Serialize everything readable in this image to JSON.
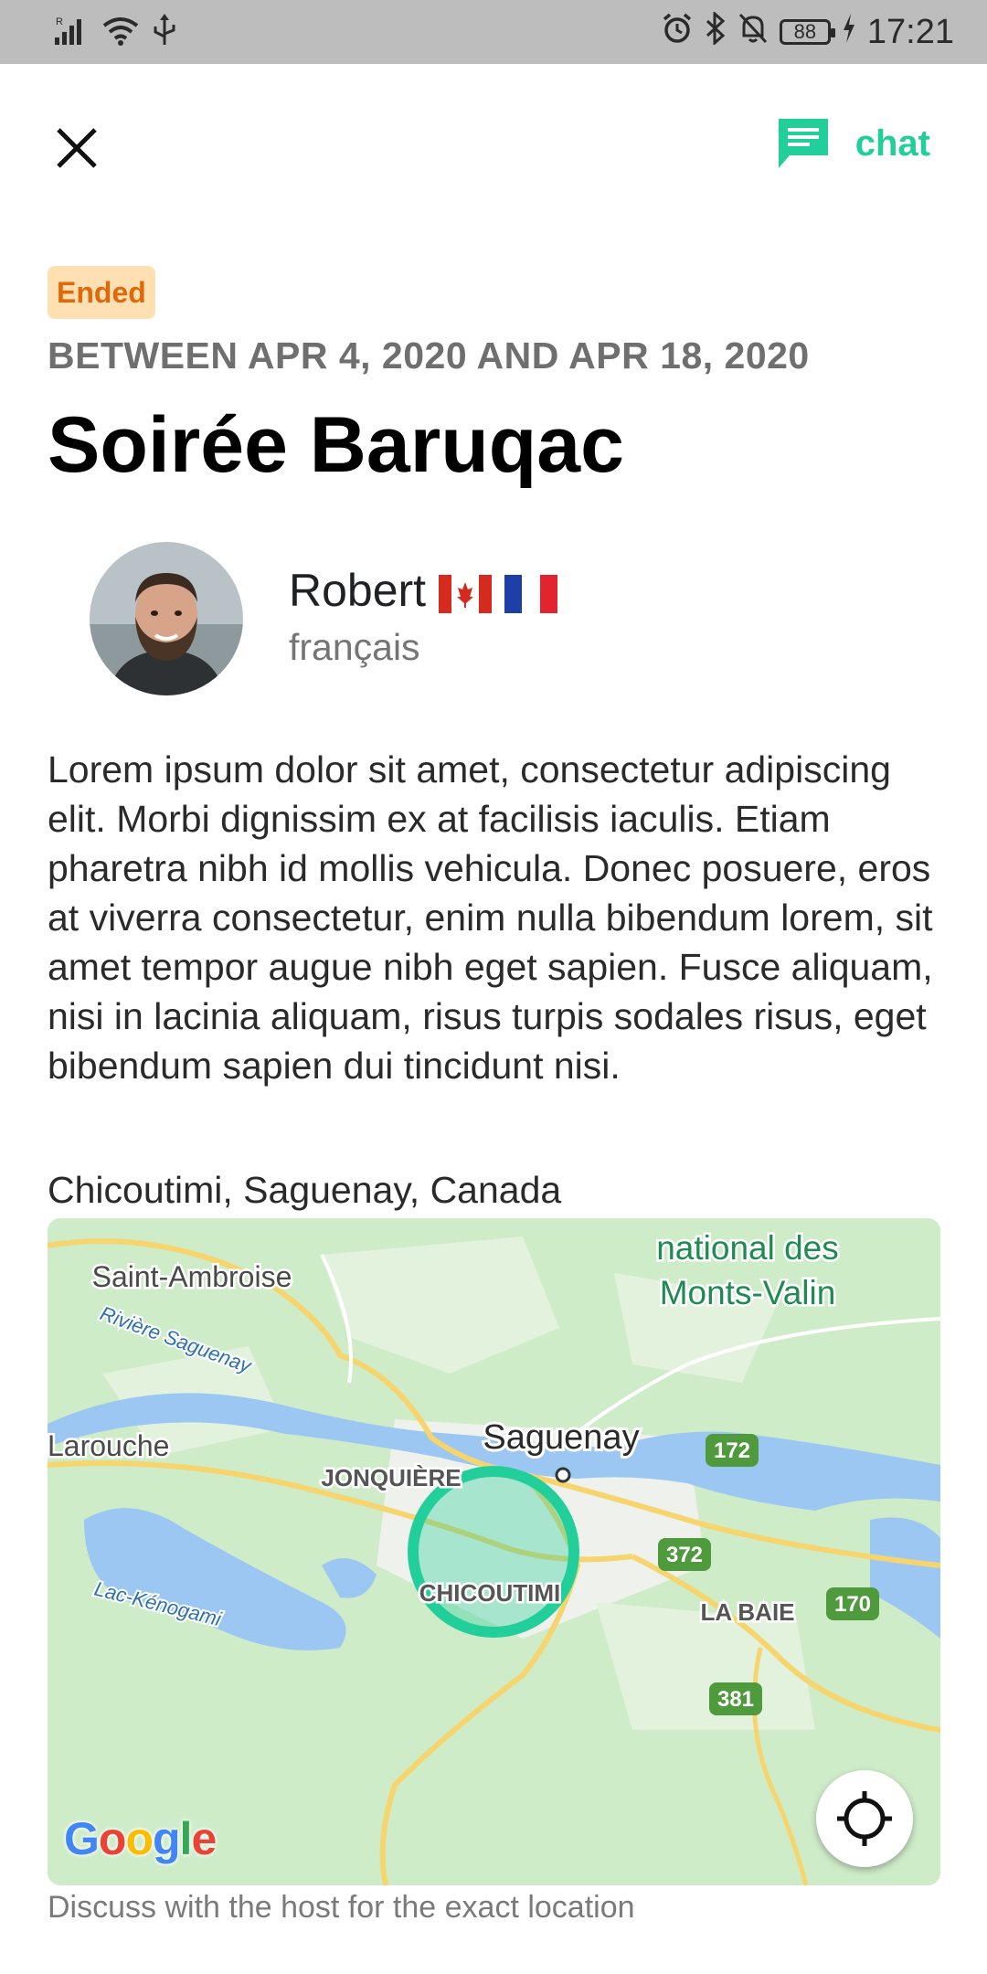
{
  "status_bar": {
    "time": "17:21",
    "battery": "88",
    "signal_label": "R"
  },
  "header": {
    "chat_label": "chat"
  },
  "event": {
    "status_badge": "Ended",
    "dates": "BETWEEN APR 4, 2020 AND APR 18, 2020",
    "title": "Soirée Baruqac"
  },
  "host": {
    "name": "Robert",
    "language": "français",
    "flags": [
      "canada-flag",
      "france-flag"
    ]
  },
  "description": "Lorem ipsum dolor sit amet, consectetur adipiscing elit. Morbi dignissim ex at facilisis iaculis. Etiam pharetra nibh id mollis vehicula. Donec posuere, eros at viverra consectetur, enim nulla bibendum lorem, sit amet tempor augue nibh eget sapien. Fusce aliquam, nisi in lacinia aliquam, risus turpis sodales risus, eget bibendum sapien dui tincidunt nisi.",
  "location": {
    "label": "Chicoutimi, Saguenay, Canada",
    "note": "Discuss with the host for the exact location"
  },
  "map": {
    "labels": {
      "park_line1": "national des",
      "park_line2": "Monts-Valin",
      "saint_ambroise": "Saint-Ambroise",
      "riviere": "Rivière Saguenay",
      "larouche": "Larouche",
      "saguenay": "Saguenay",
      "jonquiere": "JONQUIÈRE",
      "chicoutimi": "CHICOUTIMI",
      "la_baie": "LA BAIE",
      "kenogami": "Lac-Kénogami"
    },
    "shields": [
      "172",
      "372",
      "170",
      "381"
    ],
    "google": [
      "G",
      "o",
      "o",
      "g",
      "l",
      "e"
    ]
  },
  "colors": {
    "accent": "#22cf9a",
    "badge_bg": "#ffe0b3",
    "badge_text": "#e0680b"
  }
}
